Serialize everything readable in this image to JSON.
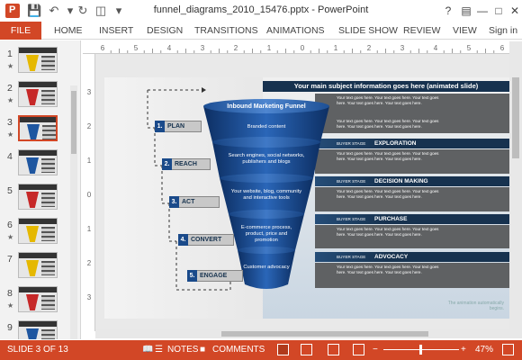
{
  "window": {
    "title": "funnel_diagrams_2010_15476.pptx - PowerPoint",
    "signin": "Sign in"
  },
  "ribbon": {
    "tabs": [
      "FILE",
      "HOME",
      "INSERT",
      "DESIGN",
      "TRANSITIONS",
      "ANIMATIONS",
      "SLIDE SHOW",
      "REVIEW",
      "VIEW"
    ]
  },
  "slides": [
    {
      "num": "1",
      "star": "★",
      "color": "#e5b800"
    },
    {
      "num": "2",
      "star": "★",
      "color": "#c62828"
    },
    {
      "num": "3",
      "star": "★",
      "color": "#1e56a0"
    },
    {
      "num": "4",
      "star": "",
      "color": "#1e56a0"
    },
    {
      "num": "5",
      "star": "",
      "color": "#c62828"
    },
    {
      "num": "6",
      "star": "★",
      "color": "#e5b800"
    },
    {
      "num": "7",
      "star": "",
      "color": "#e5b800"
    },
    {
      "num": "8",
      "star": "★",
      "color": "#c62828"
    },
    {
      "num": "9",
      "star": "",
      "color": "#1e56a0"
    }
  ],
  "ruler": {
    "h": [
      "6",
      "5",
      "4",
      "3",
      "2",
      "1",
      "0",
      "1",
      "2",
      "3",
      "4",
      "5",
      "6"
    ],
    "v": [
      "3",
      "2",
      "1",
      "0",
      "1",
      "2",
      "3"
    ]
  },
  "slide": {
    "subject": "Your main subject information goes here (animated slide)",
    "funnel_title": "Inbound Marketing Funnel",
    "body_text": "Your text goes here. Your text goes here. Your text goes here. Your text goes here. Your text goes here.",
    "buyer_stage": "BUYER STAGE",
    "stages": [
      "EXPLORATION",
      "DECISION MAKING",
      "PURCHASE",
      "ADVOCACY"
    ],
    "steps": [
      {
        "num": "1.",
        "label": "PLAN",
        "desc": "Branded content"
      },
      {
        "num": "2.",
        "label": "REACH",
        "desc": "Search engines, social networks, publishers and blogs"
      },
      {
        "num": "3.",
        "label": "ACT",
        "desc": "Your website, blog, community and interactive tools"
      },
      {
        "num": "4.",
        "label": "CONVERT",
        "desc": "E-commerce process, product, price and promotion"
      },
      {
        "num": "5.",
        "label": "ENGAGE",
        "desc": "Customer advocacy"
      }
    ],
    "note": "The animation automatically begins."
  },
  "status": {
    "slide": "SLIDE 3 OF 13",
    "notes": "NOTES",
    "comments": "COMMENTS",
    "zoom": "47%"
  },
  "colors": {
    "accent": "#d24726",
    "navy": "#17324f",
    "funnel": "#1a4f9a"
  }
}
